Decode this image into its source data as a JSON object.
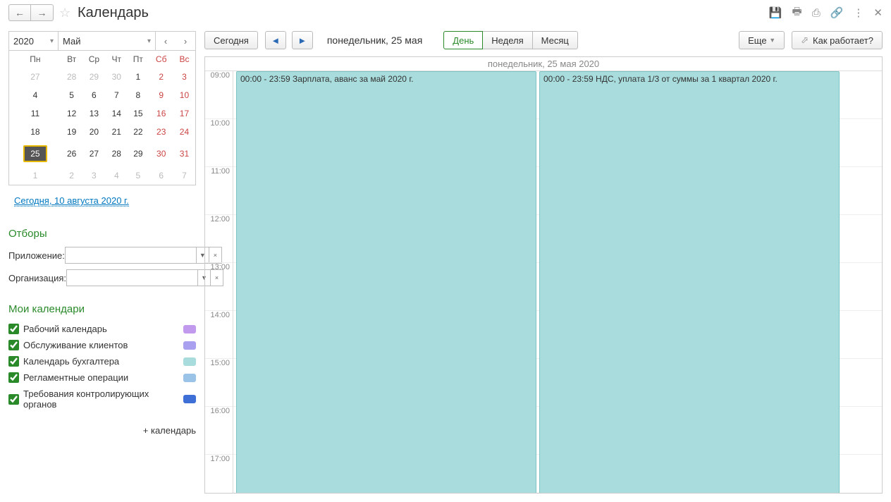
{
  "header": {
    "title": "Календарь"
  },
  "miniCal": {
    "year": "2020",
    "month": "Май",
    "dayHeaders": [
      "Пн",
      "Вт",
      "Ср",
      "Чт",
      "Пт",
      "Сб",
      "Вс"
    ],
    "weeks": [
      [
        {
          "d": "27",
          "o": 1
        },
        {
          "d": "28",
          "o": 1
        },
        {
          "d": "29",
          "o": 1
        },
        {
          "d": "30",
          "o": 1
        },
        {
          "d": "1"
        },
        {
          "d": "2",
          "w": 1
        },
        {
          "d": "3",
          "w": 1
        }
      ],
      [
        {
          "d": "4"
        },
        {
          "d": "5"
        },
        {
          "d": "6"
        },
        {
          "d": "7"
        },
        {
          "d": "8"
        },
        {
          "d": "9",
          "w": 1
        },
        {
          "d": "10",
          "w": 1
        }
      ],
      [
        {
          "d": "11"
        },
        {
          "d": "12"
        },
        {
          "d": "13"
        },
        {
          "d": "14"
        },
        {
          "d": "15"
        },
        {
          "d": "16",
          "w": 1
        },
        {
          "d": "17",
          "w": 1
        }
      ],
      [
        {
          "d": "18"
        },
        {
          "d": "19"
        },
        {
          "d": "20"
        },
        {
          "d": "21"
        },
        {
          "d": "22"
        },
        {
          "d": "23",
          "w": 1
        },
        {
          "d": "24",
          "w": 1
        }
      ],
      [
        {
          "d": "25",
          "s": 1
        },
        {
          "d": "26"
        },
        {
          "d": "27"
        },
        {
          "d": "28"
        },
        {
          "d": "29"
        },
        {
          "d": "30",
          "w": 1
        },
        {
          "d": "31",
          "w": 1
        }
      ],
      [
        {
          "d": "1",
          "o": 1
        },
        {
          "d": "2",
          "o": 1
        },
        {
          "d": "3",
          "o": 1
        },
        {
          "d": "4",
          "o": 1
        },
        {
          "d": "5",
          "o": 1
        },
        {
          "d": "6",
          "o": 1
        },
        {
          "d": "7",
          "o": 1
        }
      ]
    ],
    "todayLink": "Сегодня, 10 августа 2020 г."
  },
  "filters": {
    "title": "Отборы",
    "appLabel": "Приложение:",
    "orgLabel": "Организация:"
  },
  "myCals": {
    "title": "Мои календари",
    "items": [
      {
        "label": "Рабочий календарь",
        "color": "#c29aed"
      },
      {
        "label": "Обслуживание клиентов",
        "color": "#a9a0ef"
      },
      {
        "label": "Календарь бухгалтера",
        "color": "#a9dcdc"
      },
      {
        "label": "Регламентные операции",
        "color": "#9bc3e8"
      },
      {
        "label": "Требования контролирующих органов",
        "color": "#3e6fd6"
      }
    ],
    "addLabel": "+ календарь"
  },
  "toolbar": {
    "today": "Сегодня",
    "dateText": "понедельник, 25 мая",
    "views": {
      "day": "День",
      "week": "Неделя",
      "month": "Месяц"
    },
    "more": "Еще",
    "help": "Как работает?"
  },
  "dayView": {
    "heading": "понедельник, 25 мая 2020",
    "hours": [
      "09:00",
      "10:00",
      "11:00",
      "12:00",
      "13:00",
      "14:00",
      "15:00",
      "16:00",
      "17:00"
    ],
    "events": [
      {
        "text": "00:00 - 23:59 Зарплата, аванс за май 2020 г."
      },
      {
        "text": "00:00 - 23:59 НДС, уплата 1/3 от суммы за 1 квартал 2020 г."
      }
    ]
  }
}
